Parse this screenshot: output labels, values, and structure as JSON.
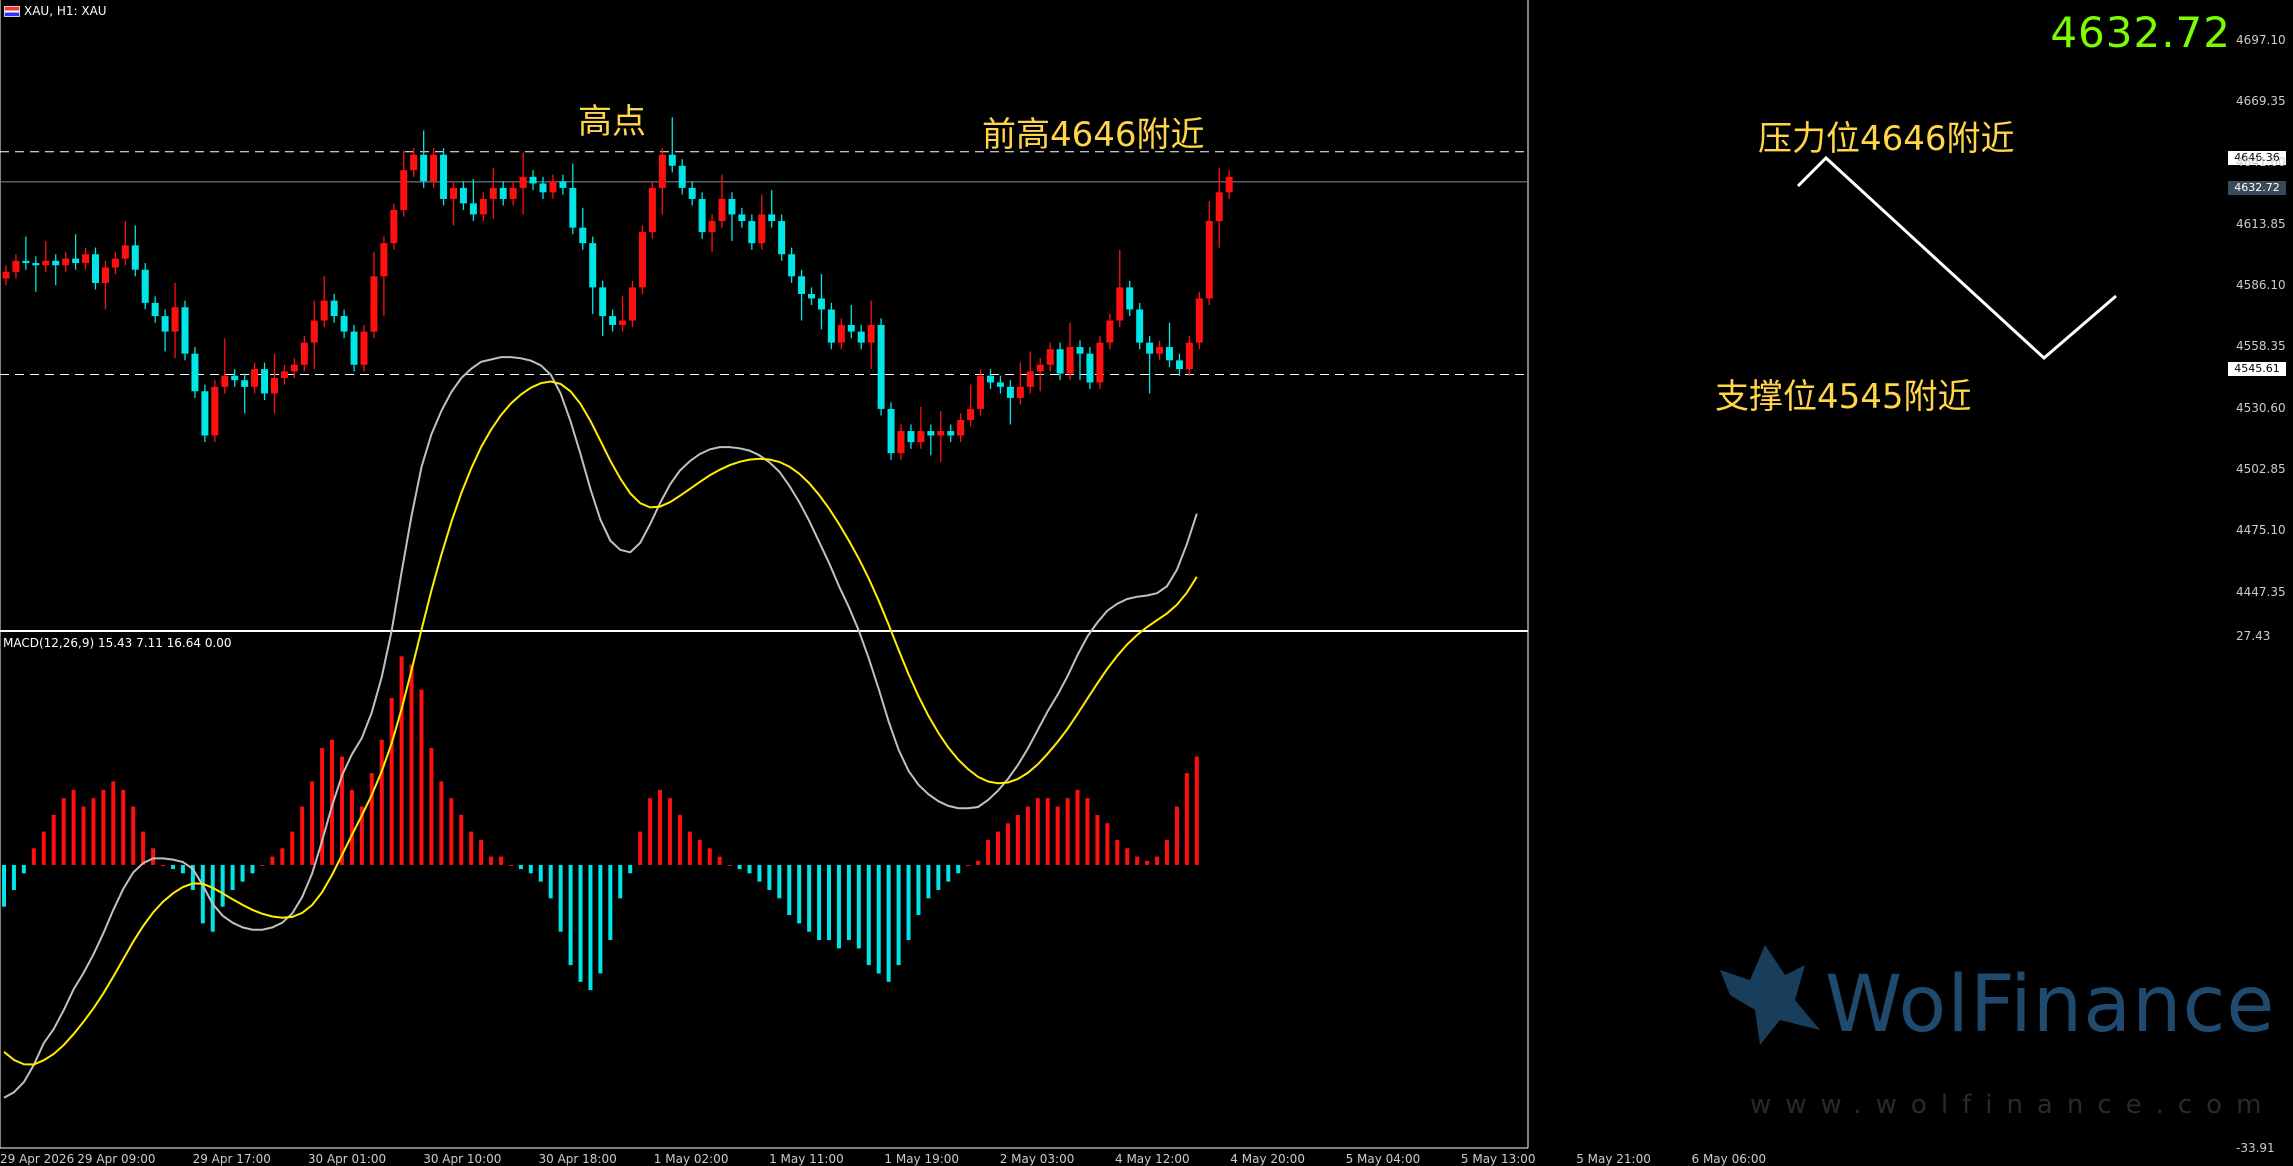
{
  "header": {
    "symbol_info": "XAU, H1: XAU"
  },
  "current_price": "4632.72",
  "annotations": {
    "high": "高点",
    "prev_high": "前高4646附近",
    "resistance": "压力位4646附近",
    "support": "支撑位4545附近"
  },
  "price_boxes": {
    "resistance": "4646.36",
    "current": "4632.72",
    "support": "4545.61"
  },
  "macd_label": "MACD(12,26,9) 15.43 7.11 16.64 0.00",
  "watermark": {
    "brand": "WolFinance",
    "url": "www.wolfinance.com"
  },
  "colors": {
    "bull": "#ff1010",
    "bear": "#00e5e5",
    "signal": "#ffee00",
    "macd_line": "#c0c0c0"
  },
  "chart_data": [
    {
      "type": "candlestick",
      "title": "XAU, H1",
      "ylim": [
        4430,
        4715
      ],
      "y_ticks": [
        "4697.10",
        "4669.35",
        "4641.60",
        "4613.85",
        "4586.10",
        "4558.35",
        "4530.60",
        "4502.85",
        "4475.10",
        "4447.35"
      ],
      "x_ticks": [
        "29 Apr 2026",
        "29 Apr 09:00",
        "29 Apr 17:00",
        "30 Apr 01:00",
        "30 Apr 10:00",
        "30 Apr 18:00",
        "1 May 02:00",
        "1 May 11:00",
        "1 May 19:00",
        "2 May 03:00",
        "4 May 12:00",
        "4 May 20:00",
        "5 May 04:00",
        "5 May 13:00",
        "5 May 21:00",
        "6 May 06:00"
      ],
      "levels": {
        "resistance": 4646.36,
        "support": 4545.61,
        "current": 4632.72
      },
      "close": [
        4592,
        4597,
        4596,
        4595,
        4597,
        4595,
        4598,
        4596,
        4600,
        4587,
        4594,
        4598,
        4604,
        4593,
        4578,
        4572,
        4565,
        4576,
        4555,
        4538,
        4518,
        4540,
        4545,
        4543,
        4540,
        4548,
        4537,
        4544,
        4547,
        4550,
        4560,
        4570,
        4579,
        4572,
        4565,
        4550,
        4565,
        4590,
        4605,
        4620,
        4638,
        4645,
        4633,
        4645,
        4625,
        4630,
        4623,
        4618,
        4625,
        4630,
        4625,
        4630,
        4635,
        4632,
        4628,
        4633,
        4630,
        4612,
        4605,
        4585,
        4572,
        4568,
        4570,
        4585,
        4610,
        4630,
        4645,
        4640,
        4630,
        4625,
        4610,
        4615,
        4625,
        4618,
        4615,
        4605,
        4618,
        4615,
        4600,
        4590,
        4582,
        4580,
        4575,
        4560,
        4568,
        4565,
        4560,
        4568,
        4530,
        4510,
        4520,
        4515,
        4520,
        4518,
        4520,
        4518,
        4525,
        4530,
        4545,
        4542,
        4540,
        4535,
        4540,
        4547,
        4550,
        4557,
        4546,
        4558,
        4555,
        4542,
        4560,
        4570,
        4585,
        4575,
        4560,
        4555,
        4558,
        4552,
        4548,
        4560,
        4580,
        4615,
        4628,
        4635
      ]
    },
    {
      "type": "macd",
      "params": "12,26,9",
      "ylim": [
        -33.91,
        27.43
      ],
      "y_ticks": [
        "27.43",
        "-33.91"
      ],
      "histogram": [
        -5,
        -3,
        -1,
        2,
        4,
        6,
        8,
        9,
        7,
        8,
        9,
        10,
        9,
        7,
        4,
        2,
        0,
        -0.5,
        -1,
        -3,
        -7,
        -8,
        -5,
        -3,
        -2,
        -1,
        0,
        1,
        2,
        4,
        7,
        10,
        14,
        15,
        13,
        9,
        7,
        11,
        15,
        20,
        25,
        24,
        21,
        14,
        10,
        8,
        6,
        4,
        3,
        1,
        1,
        0,
        -0.5,
        -1,
        -2,
        -4,
        -8,
        -12,
        -14,
        -15,
        -13,
        -9,
        -4,
        -1,
        4,
        8,
        9,
        8,
        6,
        4,
        3,
        2,
        1,
        0,
        -0.5,
        -1,
        -2,
        -3,
        -4,
        -6,
        -7,
        -8,
        -9,
        -9,
        -10,
        -9,
        -10,
        -12,
        -13,
        -14,
        -12,
        -9,
        -6,
        -4,
        -3,
        -2,
        -1,
        0,
        0.5,
        3,
        4,
        5,
        6,
        7,
        8,
        8,
        7,
        8,
        9,
        8,
        6,
        5,
        3,
        2,
        1,
        0.5,
        1,
        3,
        7,
        11,
        13
      ]
    }
  ]
}
